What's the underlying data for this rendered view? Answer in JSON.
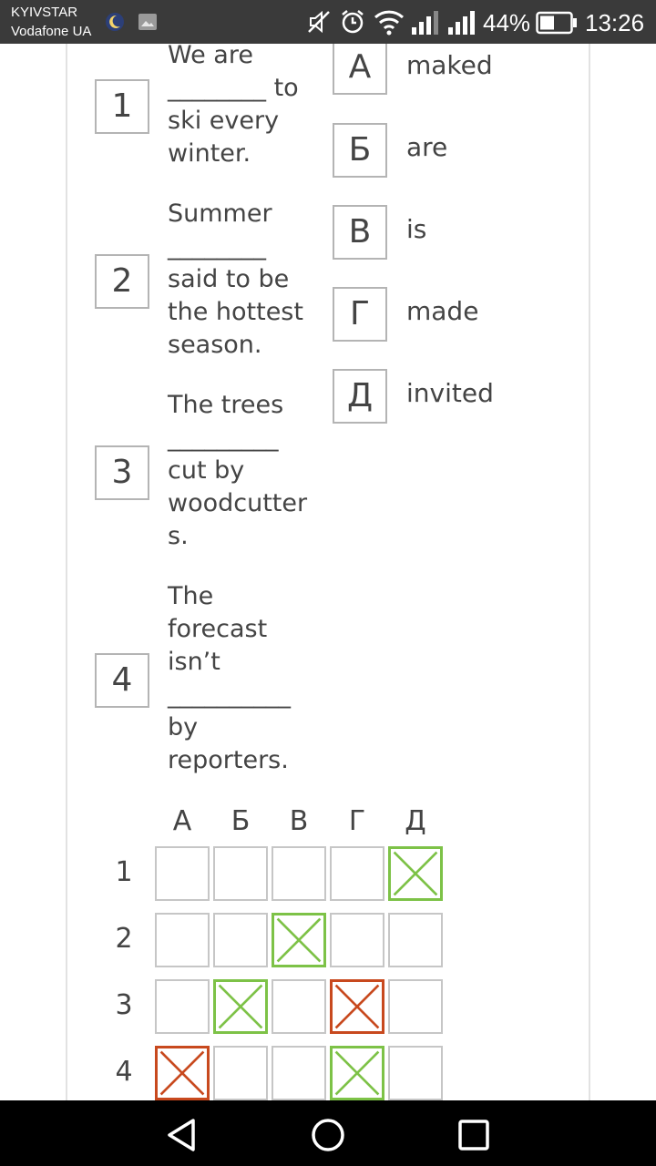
{
  "status_bar": {
    "carrier_1": "KYIVSTAR",
    "carrier_2": "Vodafone UA",
    "battery_percent": "44%",
    "time": "13:26"
  },
  "questions": [
    {
      "number": "1",
      "text": "We are\n________ to\nski every\nwinter."
    },
    {
      "number": "2",
      "text": "Summer\n________\nsaid to be\nthe hottest\nseason."
    },
    {
      "number": "3",
      "text": "The trees\n_________\ncut by\nwoodcutter\ns."
    },
    {
      "number": "4",
      "text": "The\nforecast\nisn’t\n__________\nby\nreporters."
    }
  ],
  "options": [
    {
      "letter": "А",
      "word": "maked"
    },
    {
      "letter": "Б",
      "word": "are"
    },
    {
      "letter": "В",
      "word": "is"
    },
    {
      "letter": "Г",
      "word": "made"
    },
    {
      "letter": "Д",
      "word": "invited"
    }
  ],
  "answer_grid": {
    "columns": [
      "А",
      "Б",
      "В",
      "Г",
      "Д"
    ],
    "rows": [
      "1",
      "2",
      "3",
      "4"
    ],
    "marks": [
      [
        "",
        "",
        "",
        "",
        "correct"
      ],
      [
        "",
        "",
        "correct",
        "",
        ""
      ],
      [
        "",
        "correct",
        "",
        "wrong",
        ""
      ],
      [
        "wrong",
        "",
        "",
        "correct",
        ""
      ]
    ],
    "colors": {
      "correct": "#7dc247",
      "wrong": "#c8491e"
    }
  }
}
